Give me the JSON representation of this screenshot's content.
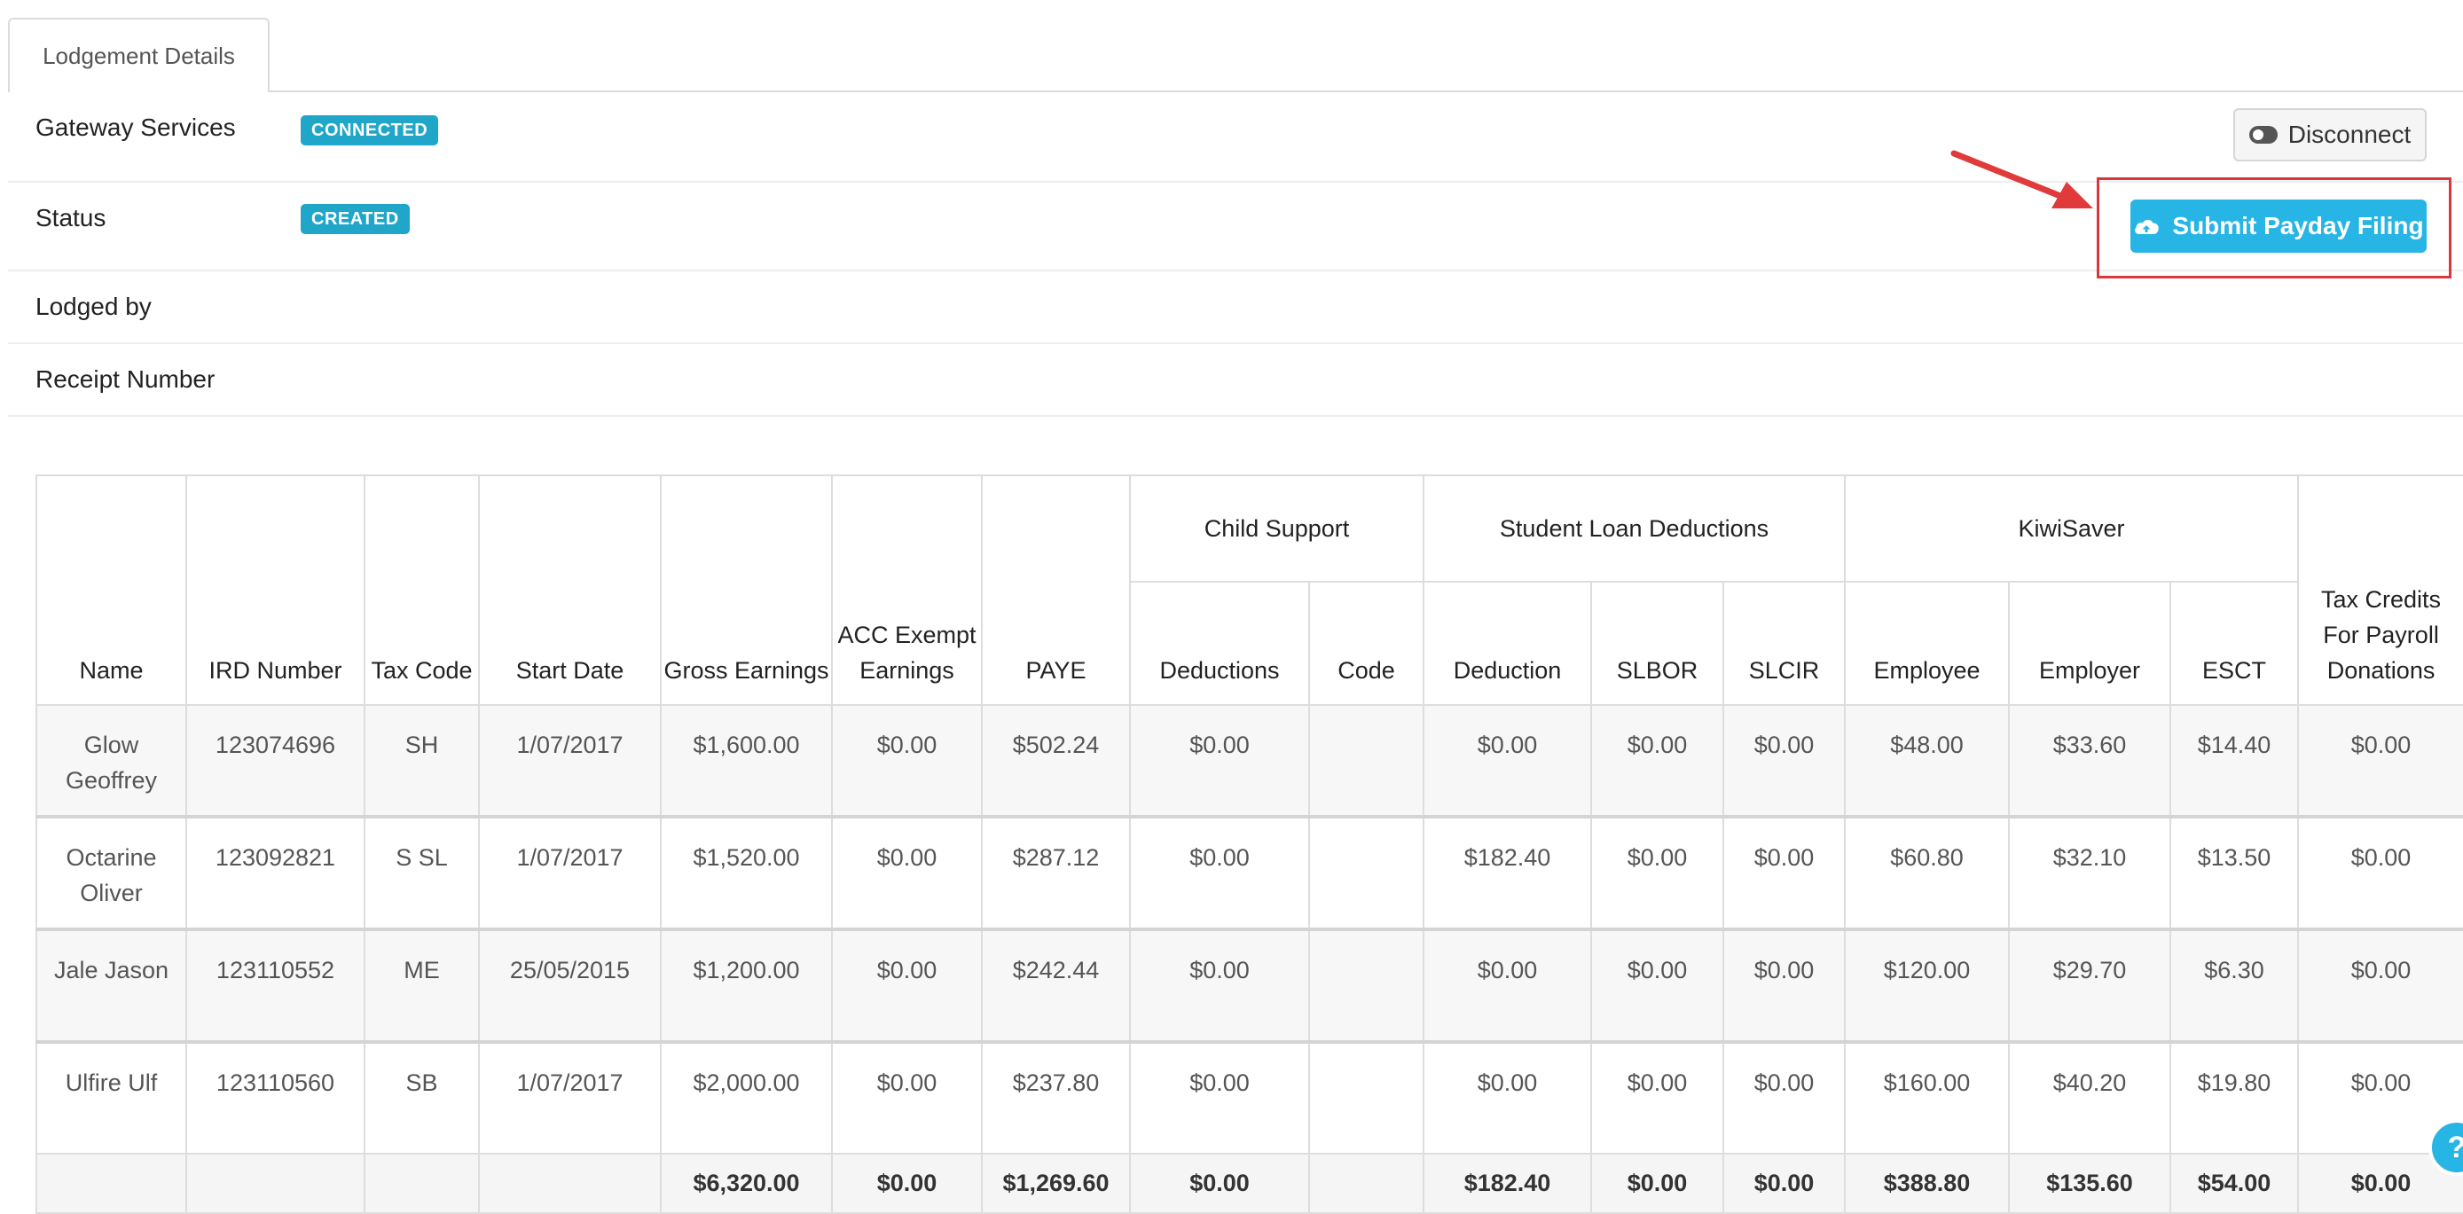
{
  "tabs": [
    {
      "label": "Lodgement Details"
    }
  ],
  "details": {
    "gateway": {
      "label": "Gateway Services",
      "badge": "CONNECTED"
    },
    "status": {
      "label": "Status",
      "badge": "CREATED"
    },
    "lodged_by": {
      "label": "Lodged by"
    },
    "receipt": {
      "label": "Receipt Number"
    }
  },
  "actions": {
    "disconnect_label": "Disconnect",
    "submit_label": "Submit Payday Filing"
  },
  "colors": {
    "accent": "#26b5e4",
    "badge": "#20a6c9",
    "highlight": "#d9363e"
  },
  "table": {
    "headers": {
      "name": "Name",
      "ird": "IRD Number",
      "tax_code": "Tax Code",
      "start_date": "Start Date",
      "gross": "Gross Earnings",
      "acc": "ACC Exempt Earnings",
      "paye": "PAYE",
      "child_support": "Child Support",
      "cs_deductions": "Deductions",
      "cs_code": "Code",
      "student_loan": "Student Loan Deductions",
      "sl_deduction": "Deduction",
      "slbor": "SLBOR",
      "slcir": "SLCIR",
      "kiwisaver": "KiwiSaver",
      "ks_employee": "Employee",
      "ks_employer": "Employer",
      "esct": "ESCT",
      "tax_credits": "Tax Credits For Payroll Donations"
    },
    "rows": [
      {
        "name": "Glow Geoffrey",
        "ird": "123074696",
        "tax_code": "SH",
        "start_date": "1/07/2017",
        "gross": "$1,600.00",
        "acc": "$0.00",
        "paye": "$502.24",
        "cs_deductions": "$0.00",
        "cs_code": "",
        "sl_deduction": "$0.00",
        "slbor": "$0.00",
        "slcir": "$0.00",
        "ks_employee": "$48.00",
        "ks_employer": "$33.60",
        "esct": "$14.40",
        "tax_credits": "$0.00"
      },
      {
        "name": "Octarine Oliver",
        "ird": "123092821",
        "tax_code": "S SL",
        "start_date": "1/07/2017",
        "gross": "$1,520.00",
        "acc": "$0.00",
        "paye": "$287.12",
        "cs_deductions": "$0.00",
        "cs_code": "",
        "sl_deduction": "$182.40",
        "slbor": "$0.00",
        "slcir": "$0.00",
        "ks_employee": "$60.80",
        "ks_employer": "$32.10",
        "esct": "$13.50",
        "tax_credits": "$0.00"
      },
      {
        "name": "Jale Jason",
        "ird": "123110552",
        "tax_code": "ME",
        "start_date": "25/05/2015",
        "gross": "$1,200.00",
        "acc": "$0.00",
        "paye": "$242.44",
        "cs_deductions": "$0.00",
        "cs_code": "",
        "sl_deduction": "$0.00",
        "slbor": "$0.00",
        "slcir": "$0.00",
        "ks_employee": "$120.00",
        "ks_employer": "$29.70",
        "esct": "$6.30",
        "tax_credits": "$0.00"
      },
      {
        "name": "Ulfire Ulf",
        "ird": "123110560",
        "tax_code": "SB",
        "start_date": "1/07/2017",
        "gross": "$2,000.00",
        "acc": "$0.00",
        "paye": "$237.80",
        "cs_deductions": "$0.00",
        "cs_code": "",
        "sl_deduction": "$0.00",
        "slbor": "$0.00",
        "slcir": "$0.00",
        "ks_employee": "$160.00",
        "ks_employer": "$40.20",
        "esct": "$19.80",
        "tax_credits": "$0.00"
      }
    ],
    "totals": {
      "gross": "$6,320.00",
      "acc": "$0.00",
      "paye": "$1,269.60",
      "cs_deductions": "$0.00",
      "sl_deduction": "$182.40",
      "slbor": "$0.00",
      "slcir": "$0.00",
      "ks_employee": "$388.80",
      "ks_employer": "$135.60",
      "esct": "$54.00",
      "tax_credits": "$0.00"
    }
  },
  "help": {
    "icon": "help-icon",
    "label": "?"
  }
}
